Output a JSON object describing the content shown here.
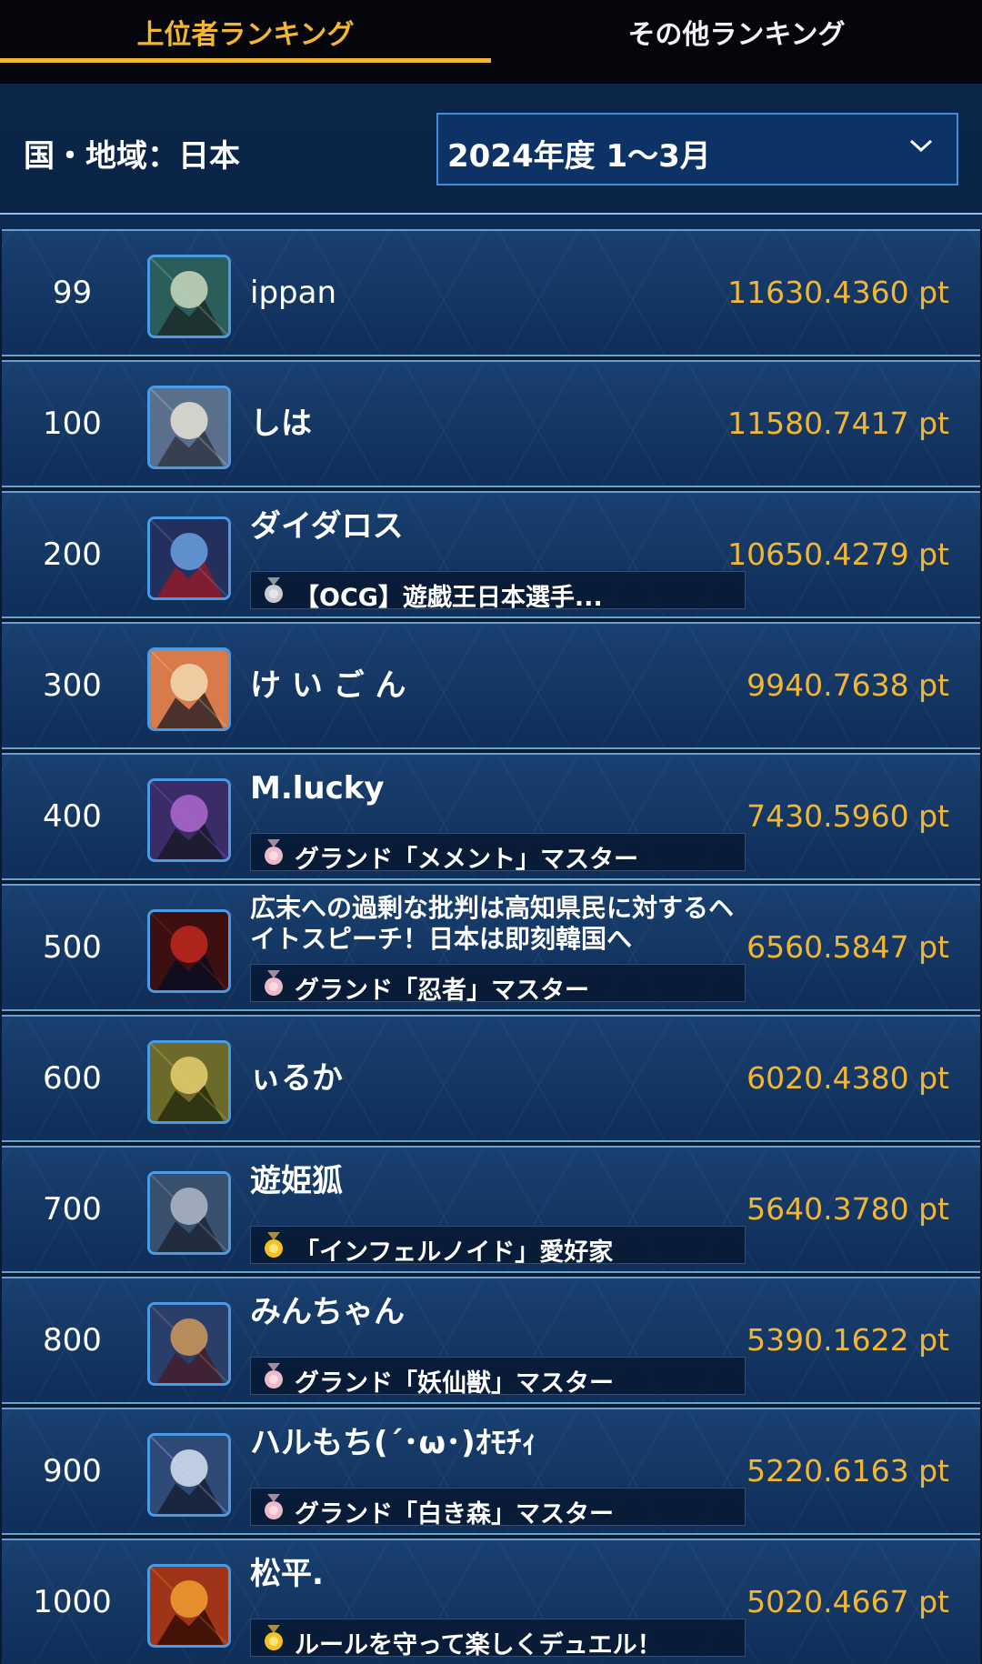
{
  "tabs": {
    "active": "上位者ランキング",
    "other": "その他ランキング"
  },
  "filter": {
    "region_label": "国・地域：日本",
    "period_value": "2024年度 1〜3月"
  },
  "colors": {
    "accent": "#f2b632",
    "background": "#071a33",
    "row": "#163a66",
    "border": "#6aa0d4"
  },
  "rows": [
    {
      "rank": "99",
      "name": "ippan",
      "title": "",
      "points": "11630.4360 pt",
      "medal": ""
    },
    {
      "rank": "100",
      "name": "しは",
      "title": "",
      "points": "11580.7417 pt",
      "medal": ""
    },
    {
      "rank": "200",
      "name": "ダイダロス",
      "title": "【OCG】遊戯王日本選手...",
      "points": "10650.4279 pt",
      "medal": "silver"
    },
    {
      "rank": "300",
      "name": "け い ご ん",
      "title": "",
      "points": "9940.7638 pt",
      "medal": ""
    },
    {
      "rank": "400",
      "name": "M.lucky",
      "title": "グランド「メメント」マスター",
      "points": "7430.5960 pt",
      "medal": "pink"
    },
    {
      "rank": "500",
      "name": "広末への過剰な批判は高知県民に対するヘイトスピーチ！日本は即刻韓国へ",
      "title": "グランド「忍者」マスター",
      "points": "6560.5847 pt",
      "medal": "pink"
    },
    {
      "rank": "600",
      "name": "ぃるか",
      "title": "",
      "points": "6020.4380 pt",
      "medal": ""
    },
    {
      "rank": "700",
      "name": "遊姫狐",
      "title": "「インフェルノイド」愛好家",
      "points": "5640.3780 pt",
      "medal": "gold"
    },
    {
      "rank": "800",
      "name": "みんちゃん",
      "title": "グランド「妖仙獣」マスター",
      "points": "5390.1622 pt",
      "medal": "pink"
    },
    {
      "rank": "900",
      "name": "ハルもち(´･ω･)ｵﾓﾁｨ",
      "title": "グランド「白き森」マスター",
      "points": "5220.6163 pt",
      "medal": "pink"
    },
    {
      "rank": "1000",
      "name": "松平.",
      "title": "ルールを守って楽しくデュエル！",
      "points": "5020.4667 pt",
      "medal": "gold"
    }
  ]
}
